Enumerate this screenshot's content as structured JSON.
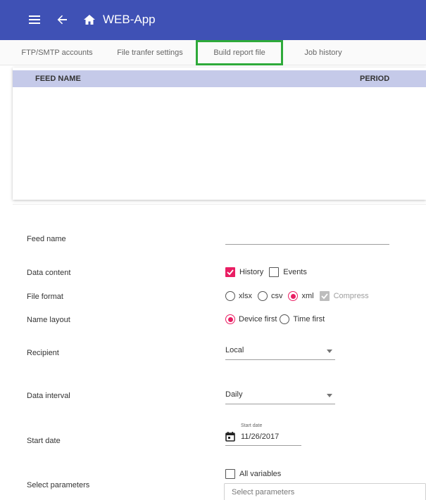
{
  "appbar": {
    "title": "WEB-App",
    "icons": [
      "menu-icon",
      "back-arrow-icon",
      "home-icon"
    ],
    "color": "#3f51b5"
  },
  "tabs": [
    {
      "label": "FTP/SMTP accounts"
    },
    {
      "label": "File tranfer settings"
    },
    {
      "label": "Build report file",
      "active": true
    },
    {
      "label": "Job history"
    }
  ],
  "table": {
    "columns": [
      "FEED NAME",
      "PERIOD"
    ]
  },
  "form": {
    "feed_name": {
      "label": "Feed name",
      "value": ""
    },
    "data_content": {
      "label": "Data content",
      "options": [
        {
          "label": "History",
          "checked": true
        },
        {
          "label": "Events",
          "checked": false
        }
      ]
    },
    "file_format": {
      "label": "File format",
      "options": [
        "xlsx",
        "csv",
        "xml"
      ],
      "selected": "xml",
      "compress_label": "Compress",
      "compress_checked": true,
      "compress_disabled": true
    },
    "name_layout": {
      "label": "Name layout",
      "options": [
        "Device first",
        "Time first"
      ],
      "selected": "Device first"
    },
    "recipient": {
      "label": "Recipient",
      "value": "Local"
    },
    "data_interval": {
      "label": "Data interval",
      "value": "Daily"
    },
    "start_date": {
      "label": "Start date",
      "field_label": "Start date",
      "value": "11/26/2017"
    },
    "select_parameters": {
      "label": "Select parameters",
      "all_variables_label": "All variables",
      "all_variables_checked": false,
      "placeholder": "Select parameters"
    }
  },
  "colors": {
    "accent": "#e91e63",
    "highlight_outline": "#2eaa3a",
    "table_header": "#c5cae9"
  }
}
